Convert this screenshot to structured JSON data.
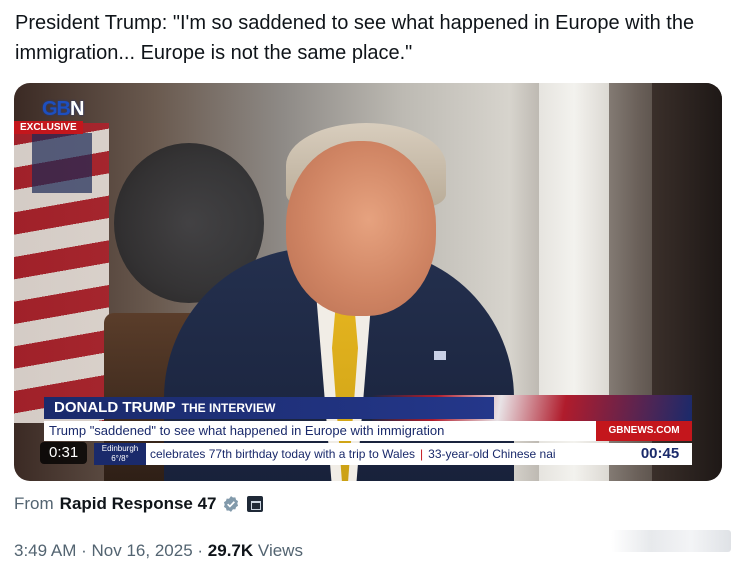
{
  "tweet": {
    "text": "President Trump: \"I'm so saddened to see what happened in Europe with the immigration... Europe is not the same place.\""
  },
  "video": {
    "logo_text_main": "GB",
    "logo_text_accent": "N",
    "badge": "EXCLUSIVE",
    "lower_third_title": "DONALD TRUMP",
    "lower_third_subtitle": "THE INTERVIEW",
    "headline": "Trump \"saddened\" to see what happened in Europe with immigration",
    "site": "GBNEWS.COM",
    "weather_city": "Edinburgh",
    "weather_temp": "6°/8°",
    "ticker_item_1": "celebrates 77th birthday today with a trip to Wales",
    "ticker_item_2": "33-year-old Chinese nai",
    "clock": "00:45",
    "elapsed": "0:31"
  },
  "source": {
    "label": "From",
    "name": "Rapid Response 47"
  },
  "meta": {
    "time": "3:49 AM",
    "separator": "·",
    "date": "Nov 16, 2025",
    "views_count": "29.7K",
    "views_label": "Views"
  },
  "colors": {
    "verified_badge": "#829aab",
    "gbn_red": "#c4161c",
    "gbn_navy": "#1a2a6b"
  },
  "icons": [
    "verified-badge-icon",
    "affiliate-badge-icon"
  ]
}
